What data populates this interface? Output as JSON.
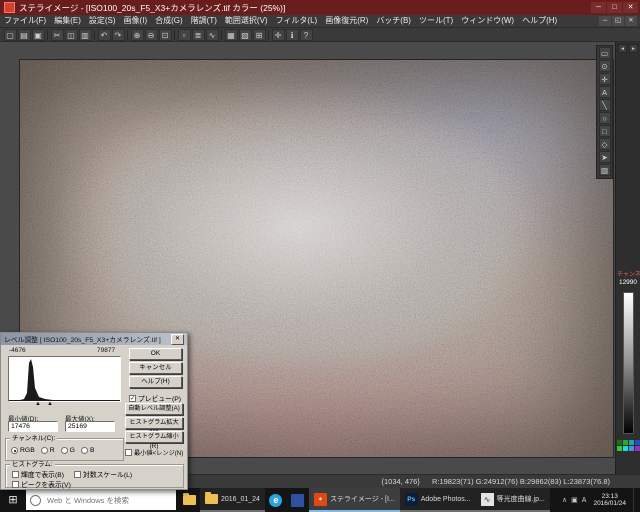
{
  "colors": {
    "titlebar": "#6a1d1d",
    "taskbar_accent": "#85b9e8"
  },
  "titlebar": {
    "title": "ステライメージ - [ISO100_20s_F5_X3+カメラレンズ.tif カラー (25%)]",
    "minimize": "─",
    "maximize": "□",
    "close": "✕"
  },
  "menubar": {
    "items": [
      "ファイル(F)",
      "編集(E)",
      "設定(S)",
      "画像(I)",
      "合成(G)",
      "階調(T)",
      "範囲選択(V)",
      "フィルタ(L)",
      "画像復元(R)",
      "バッチ(B)",
      "ツール(T)",
      "ウィンドウ(W)",
      "ヘルプ(H)"
    ],
    "child_controls": [
      "─",
      "◱",
      "✕"
    ]
  },
  "toolbar": {
    "icons": [
      {
        "name": "file-new",
        "glyph": "▢"
      },
      {
        "name": "file-open",
        "glyph": "▤"
      },
      {
        "name": "file-save",
        "glyph": "▣"
      },
      {
        "name": "cut",
        "glyph": "✂"
      },
      {
        "name": "copy",
        "glyph": "◫"
      },
      {
        "name": "paste",
        "glyph": "▥"
      },
      {
        "name": "undo",
        "glyph": "↶"
      },
      {
        "name": "redo",
        "glyph": "↷"
      },
      {
        "name": "zoom-in",
        "glyph": "⊕"
      },
      {
        "name": "zoom-out",
        "glyph": "⊖"
      },
      {
        "name": "zoom-fit",
        "glyph": "⊡"
      },
      {
        "name": "select-area",
        "glyph": "▫"
      },
      {
        "name": "levels",
        "glyph": "≣"
      },
      {
        "name": "curves",
        "glyph": "∿"
      },
      {
        "name": "histogram",
        "glyph": "▦"
      },
      {
        "name": "channels",
        "glyph": "▧"
      },
      {
        "name": "grid",
        "glyph": "⊞"
      },
      {
        "name": "measure",
        "glyph": "✛"
      },
      {
        "name": "info",
        "glyph": "ℹ"
      },
      {
        "name": "help",
        "glyph": "?"
      }
    ]
  },
  "palette": {
    "icons": [
      {
        "name": "select",
        "glyph": "▭"
      },
      {
        "name": "zoom",
        "glyph": "⊙"
      },
      {
        "name": "pan",
        "glyph": "✛"
      },
      {
        "name": "text",
        "glyph": "A"
      },
      {
        "name": "line",
        "glyph": "╲"
      },
      {
        "name": "circle",
        "glyph": "○"
      },
      {
        "name": "rectangle",
        "glyph": "□"
      },
      {
        "name": "polygon",
        "glyph": "◇"
      },
      {
        "name": "arrow",
        "glyph": "➤"
      },
      {
        "name": "picker",
        "glyph": "▧"
      }
    ]
  },
  "right_panel": {
    "collapse_left": "◂",
    "collapse_right": "▸",
    "label": "チャンネル",
    "value": "12990",
    "swatches": [
      "#1c6e1c",
      "#25b025",
      "#18a8a8",
      "#2050b8",
      "#30c830",
      "#20dcdc",
      "#4890e8",
      "#8838c0"
    ]
  },
  "dialog": {
    "title": "レベル調整 [ ISO100_20s_F5_X3+カメラレンズ.tif ]",
    "close_glyph": "✕",
    "hist_range_min": "-4676",
    "hist_range_max": "79877",
    "ok": "OK",
    "cancel": "キャンセル",
    "help": "ヘルプ(H)",
    "preview": {
      "label": "プレビュー(P)",
      "mark": "✓"
    },
    "auto": "自動レベル調整(A)",
    "hist_zoom_in": "ヒストグラム拡大(W)",
    "hist_zoom_out": "ヒストグラム縮小(R)",
    "range_check": {
      "label": "最小値<レンジ(N)",
      "mark": ""
    },
    "min_label": "最小値(D):",
    "min_value": "17476",
    "max_label": "最大値(X):",
    "max_value": "25169",
    "channel_legend": "チャンネル(C):",
    "channels": [
      {
        "label": "RGB"
      },
      {
        "label": "R"
      },
      {
        "label": "G"
      },
      {
        "label": "B"
      }
    ],
    "hist_legend": "ヒストグラム:",
    "hist_checks": [
      {
        "label": "輝度で表示(B)",
        "mark": ""
      },
      {
        "label": "対数スケール(L)",
        "mark": ""
      },
      {
        "label": "ピークを表示(V)",
        "mark": ""
      }
    ]
  },
  "statusbar": {
    "coords": "{1034, 476}",
    "rgb": "R:19823(71)  G:24912(76)  B:29862(83)  L:23873(76.8)"
  },
  "taskbar": {
    "start_glyph": "⊞",
    "search_placeholder": "Web と Windows を検索",
    "windows": [
      {
        "label": "2016_01_24"
      },
      {
        "label": "ステライメージ - [I..."
      },
      {
        "label": "Adobe Photos..."
      },
      {
        "label": "等光度曲線.jp..."
      }
    ],
    "ps_glyph": "Ps",
    "edge_glyph": "e",
    "graph_glyph": "∿",
    "stella_glyph": "✶",
    "tray_icons": [
      "∧",
      "▣",
      "A"
    ],
    "clock_time": "23:13",
    "clock_date": "2016/01/24"
  }
}
